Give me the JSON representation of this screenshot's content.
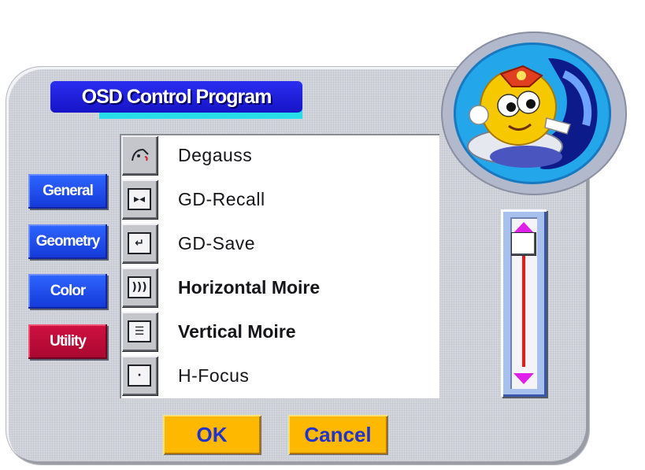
{
  "window": {
    "title": "OSD Control Program"
  },
  "sidebar": {
    "items": [
      {
        "label": "General",
        "active": false
      },
      {
        "label": "Geometry",
        "active": false
      },
      {
        "label": "Color",
        "active": false
      },
      {
        "label": "Utility",
        "active": true
      }
    ]
  },
  "list": {
    "items": [
      {
        "label": "Degauss",
        "icon": "degauss-icon"
      },
      {
        "label": "GD-Recall",
        "icon": "recall-icon"
      },
      {
        "label": "GD-Save",
        "icon": "save-icon"
      },
      {
        "label": "Horizontal Moire",
        "icon": "horizontal-moire-icon"
      },
      {
        "label": "Vertical Moire",
        "icon": "vertical-moire-icon"
      },
      {
        "label": "H-Focus",
        "icon": "focus-icon"
      }
    ]
  },
  "buttons": {
    "ok": "OK",
    "cancel": "Cancel"
  },
  "colors": {
    "title_blue": "#1f1fe0",
    "title_cyan": "#28dde8",
    "nav_blue": "#2450f0",
    "nav_active": "#c00c36",
    "button_yellow": "#ffb800",
    "button_text": "#2233cc",
    "scroll_arrow": "#e020e8",
    "scroll_line": "#f01818"
  }
}
